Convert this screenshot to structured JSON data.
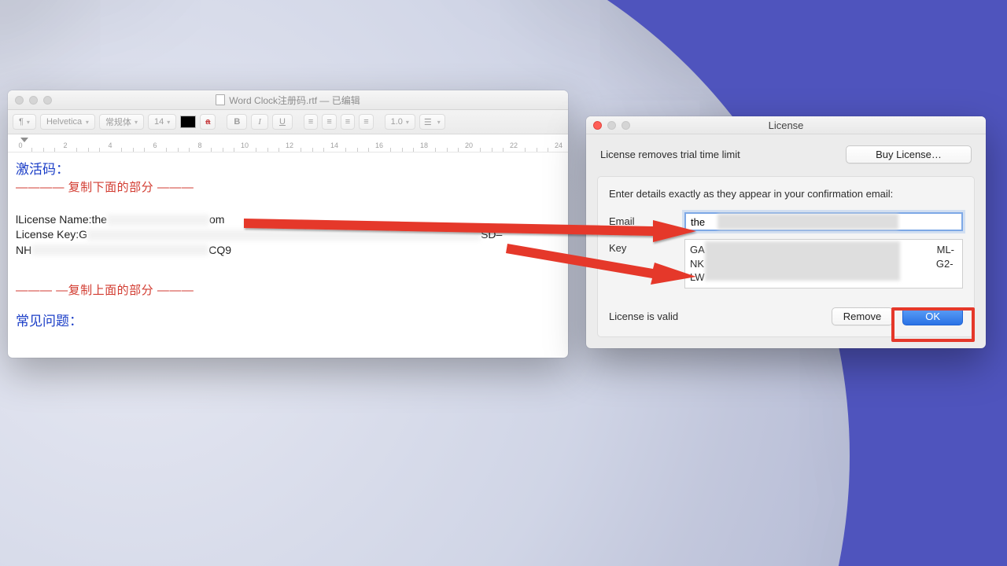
{
  "textedit": {
    "title": "Word Clock注册码.rtf — 已编辑",
    "toolbar": {
      "style_menu": "¶",
      "font": "Helvetica",
      "weight": "常规体",
      "size": "14",
      "bold": "B",
      "italic": "I",
      "underline": "U",
      "line_spacing": "1.0"
    },
    "ruler_ticks": [
      "0",
      "2",
      "4",
      "6",
      "8",
      "10",
      "12",
      "14",
      "16",
      "18",
      "20",
      "22",
      "24"
    ],
    "body": {
      "heading": "激活码：",
      "sep_top": "———— 复制下面的部分 ———",
      "license_name_label": "lLicense Name: ",
      "license_name_prefix": "the",
      "license_name_suffix": "om",
      "license_key_label": "License Key: ",
      "license_key_prefix": "G",
      "license_key_mid_tail": "SD–",
      "license_key_line2_prefix": "NH",
      "license_key_line2_suffix": "CQ9",
      "sep_bottom": "——— —复制上面的部分 ———",
      "faq": "常见问题："
    }
  },
  "license": {
    "title": "License",
    "desc": "License removes trial time limit",
    "buy_btn": "Buy License…",
    "enter_details": "Enter details exactly as they appear in your confirmation email:",
    "email_label": "Email",
    "email_value": "the",
    "key_label": "Key",
    "key_line1_pre": "GA",
    "key_line1_suf": "ML-",
    "key_line2_pre": "NK",
    "key_line2_suf": "G2-",
    "key_line3": "LW",
    "status": "License is valid",
    "remove_btn": "Remove",
    "ok_btn": "OK"
  }
}
